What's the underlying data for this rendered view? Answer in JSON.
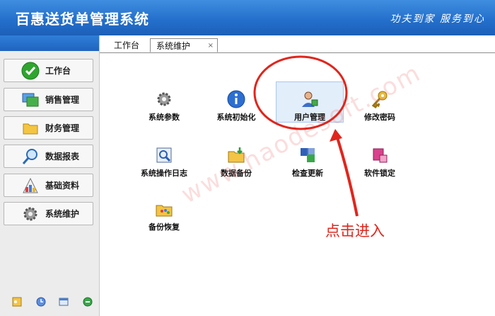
{
  "header": {
    "title": "百惠送货单管理系统",
    "slogan": "功夫到家 服务到心"
  },
  "sidebar": {
    "items": [
      {
        "label": "工作台",
        "icon": "check-icon"
      },
      {
        "label": "销售管理",
        "icon": "monitor-icon"
      },
      {
        "label": "财务管理",
        "icon": "folder-icon"
      },
      {
        "label": "数据报表",
        "icon": "magnifier-icon"
      },
      {
        "label": "基础资料",
        "icon": "palette-icon"
      },
      {
        "label": "系统维护",
        "icon": "gear-icon"
      }
    ],
    "footer_icons": [
      "key-icon",
      "clock-icon",
      "window-icon",
      "exit-icon"
    ]
  },
  "tabs": {
    "workbench": "工作台",
    "system": "系统维护",
    "close": "×"
  },
  "functions": [
    {
      "label": "系统参数",
      "icon": "gear-icon"
    },
    {
      "label": "系统初始化",
      "icon": "info-icon"
    },
    {
      "label": "用户管理",
      "icon": "user-icon"
    },
    {
      "label": "修改密码",
      "icon": "key-icon"
    },
    {
      "label": "系统操作日志",
      "icon": "log-icon"
    },
    {
      "label": "数据备份",
      "icon": "backup-icon"
    },
    {
      "label": "检查更新",
      "icon": "update-icon"
    },
    {
      "label": "软件锁定",
      "icon": "lock-icon"
    },
    {
      "label": "备份恢复",
      "icon": "restore-icon"
    }
  ],
  "annotation": {
    "text": "点击进入",
    "color": "#e0261d"
  },
  "watermark": "www.haodesoft.com",
  "colors": {
    "header": "#2470cc",
    "accent_red": "#e0261d",
    "selected_bg": "#e3eefb"
  }
}
